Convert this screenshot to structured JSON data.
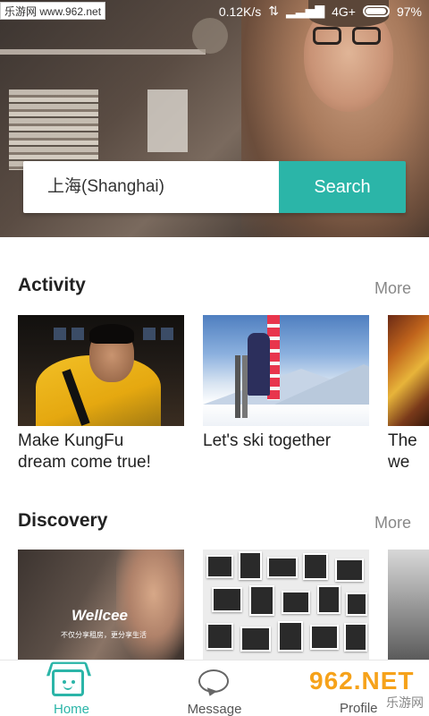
{
  "status_bar": {
    "watermark": "乐游网 www.962.net",
    "network_speed": "0.12K/s",
    "network_type": "4G+",
    "battery": "97%"
  },
  "search": {
    "value": "上海(Shanghai)",
    "button_label": "Search"
  },
  "activity": {
    "title": "Activity",
    "more_label": "More",
    "cards": [
      {
        "caption_line1": "Make KungFu",
        "caption_line2": "dream come true!"
      },
      {
        "caption_line1": "Let's ski together",
        "caption_line2": ""
      },
      {
        "caption_line1": "The",
        "caption_line2": "we"
      }
    ]
  },
  "discovery": {
    "title": "Discovery",
    "more_label": "More",
    "card1": {
      "logo": "Wellcee",
      "slogan": "不仅分享租房，更分享生活"
    }
  },
  "nav": {
    "items": [
      {
        "label": "Home",
        "icon": "home-icon",
        "active": true
      },
      {
        "label": "Message",
        "icon": "message-icon",
        "active": false
      },
      {
        "label": "Profile",
        "icon": "profile-icon",
        "active": false
      }
    ]
  },
  "overlay_badge": {
    "brand": "962.NET",
    "subtitle": "乐游网"
  },
  "colors": {
    "accent": "#2bb5a8",
    "more_gray": "#888888"
  }
}
